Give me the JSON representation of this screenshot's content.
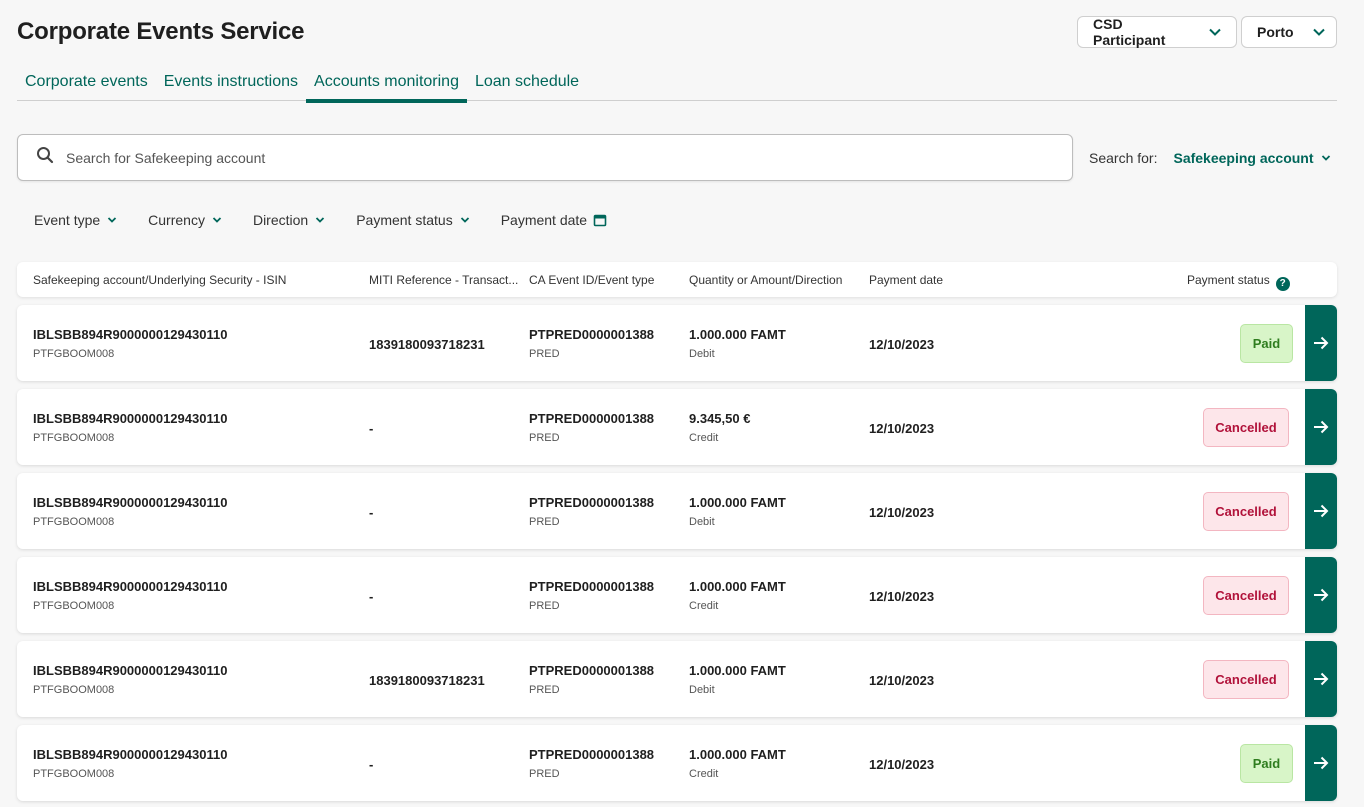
{
  "app": {
    "title": "Corporate Events Service"
  },
  "selectors": {
    "participant": "CSD Participant",
    "location": "Porto"
  },
  "tabs": [
    {
      "label": "Corporate events",
      "active": false
    },
    {
      "label": "Events instructions",
      "active": false
    },
    {
      "label": "Accounts monitoring",
      "active": true
    },
    {
      "label": "Loan schedule",
      "active": false
    }
  ],
  "search": {
    "placeholder": "Search for Safekeeping account",
    "search_for_label": "Search for:",
    "search_for_value": "Safekeeping account"
  },
  "filters": [
    "Event type",
    "Currency",
    "Direction",
    "Payment status",
    "Payment date"
  ],
  "table": {
    "headers": [
      "Safekeeping account/Underlying Security - ISIN",
      "MITI Reference - Transact...",
      "CA Event ID/Event type",
      "Quantity or Amount/Direction",
      "Payment date",
      "Payment status"
    ],
    "rows": [
      {
        "account": "IBLSBB894R9000000129430110",
        "isin": "PTFGBOOM008",
        "miti": "1839180093718231",
        "event_id": "PTPRED0000001388",
        "event_type": "PRED",
        "amount": "1.000.000 FAMT",
        "direction": "Debit",
        "date": "12/10/2023",
        "status": "Paid"
      },
      {
        "account": "IBLSBB894R9000000129430110",
        "isin": "PTFGBOOM008",
        "miti": "-",
        "event_id": "PTPRED0000001388",
        "event_type": "PRED",
        "amount": "9.345,50 €",
        "direction": "Credit",
        "date": "12/10/2023",
        "status": "Cancelled"
      },
      {
        "account": "IBLSBB894R9000000129430110",
        "isin": "PTFGBOOM008",
        "miti": "-",
        "event_id": "PTPRED0000001388",
        "event_type": "PRED",
        "amount": "1.000.000 FAMT",
        "direction": "Debit",
        "date": "12/10/2023",
        "status": "Cancelled"
      },
      {
        "account": "IBLSBB894R9000000129430110",
        "isin": "PTFGBOOM008",
        "miti": "-",
        "event_id": "PTPRED0000001388",
        "event_type": "PRED",
        "amount": "1.000.000 FAMT",
        "direction": "Credit",
        "date": "12/10/2023",
        "status": "Cancelled"
      },
      {
        "account": "IBLSBB894R9000000129430110",
        "isin": "PTFGBOOM008",
        "miti": "1839180093718231",
        "event_id": "PTPRED0000001388",
        "event_type": "PRED",
        "amount": "1.000.000 FAMT",
        "direction": "Debit",
        "date": "12/10/2023",
        "status": "Cancelled"
      },
      {
        "account": "IBLSBB894R9000000129430110",
        "isin": "PTFGBOOM008",
        "miti": "-",
        "event_id": "PTPRED0000001388",
        "event_type": "PRED",
        "amount": "1.000.000 FAMT",
        "direction": "Credit",
        "date": "12/10/2023",
        "status": "Paid"
      }
    ]
  },
  "colors": {
    "brand": "#00665a",
    "paid": "#2f7d1f",
    "cancelled": "#b1123a"
  }
}
